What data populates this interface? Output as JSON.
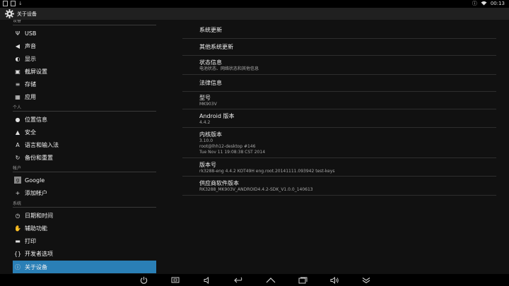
{
  "status_bar": {
    "time": "00:13"
  },
  "action_bar": {
    "title": "关于设备"
  },
  "sidebar": {
    "partial_header": "设备",
    "device_items": [
      {
        "label": "USB",
        "icon": "usb-icon"
      },
      {
        "label": "声音",
        "icon": "sound-icon"
      },
      {
        "label": "显示",
        "icon": "display-icon"
      },
      {
        "label": "截屏设置",
        "icon": "screenshot-icon"
      },
      {
        "label": "存储",
        "icon": "storage-icon"
      },
      {
        "label": "应用",
        "icon": "apps-icon"
      }
    ],
    "personal_header": "个人",
    "personal_items": [
      {
        "label": "位置信息",
        "icon": "location-icon"
      },
      {
        "label": "安全",
        "icon": "lock-icon"
      },
      {
        "label": "语言和输入法",
        "icon": "language-icon"
      },
      {
        "label": "备份和重置",
        "icon": "backup-icon"
      }
    ],
    "accounts_header": "帐户",
    "account_items": [
      {
        "label": "Google",
        "icon": "google-icon"
      },
      {
        "label": "添加帐户",
        "icon": "add-icon"
      }
    ],
    "system_header": "系统",
    "system_items": [
      {
        "label": "日期和时间",
        "icon": "clock-icon"
      },
      {
        "label": "辅助功能",
        "icon": "accessibility-icon"
      },
      {
        "label": "打印",
        "icon": "print-icon"
      },
      {
        "label": "开发者选项",
        "icon": "developer-icon"
      },
      {
        "label": "关于设备",
        "icon": "info-icon"
      }
    ]
  },
  "about": {
    "system_update": "系统更新",
    "other_update": "其他系统更新",
    "status_title": "状态信息",
    "status_summary": "电池状态、网络状态和其他信息",
    "legal": "法律信息",
    "model_title": "型号",
    "model_value": "MK903V",
    "android_title": "Android 版本",
    "android_value": "4.4.2",
    "kernel_title": "内核版本",
    "kernel_value": "3.10.0\nroot@lhh12-desktop #146\nTue Nov 11 19:08:38 CST 2014",
    "build_title": "版本号",
    "build_value": "rk3288-eng 4.4.2 KOT49H eng.root.20141111.093942 test-keys",
    "vendor_title": "供应商软件版本",
    "vendor_value": "RK3288_MK903V_ANDROID4.4.2-SDK_V1.0.0_140613"
  },
  "colors": {
    "active": "#2a7fb6",
    "panel": "#111111"
  }
}
